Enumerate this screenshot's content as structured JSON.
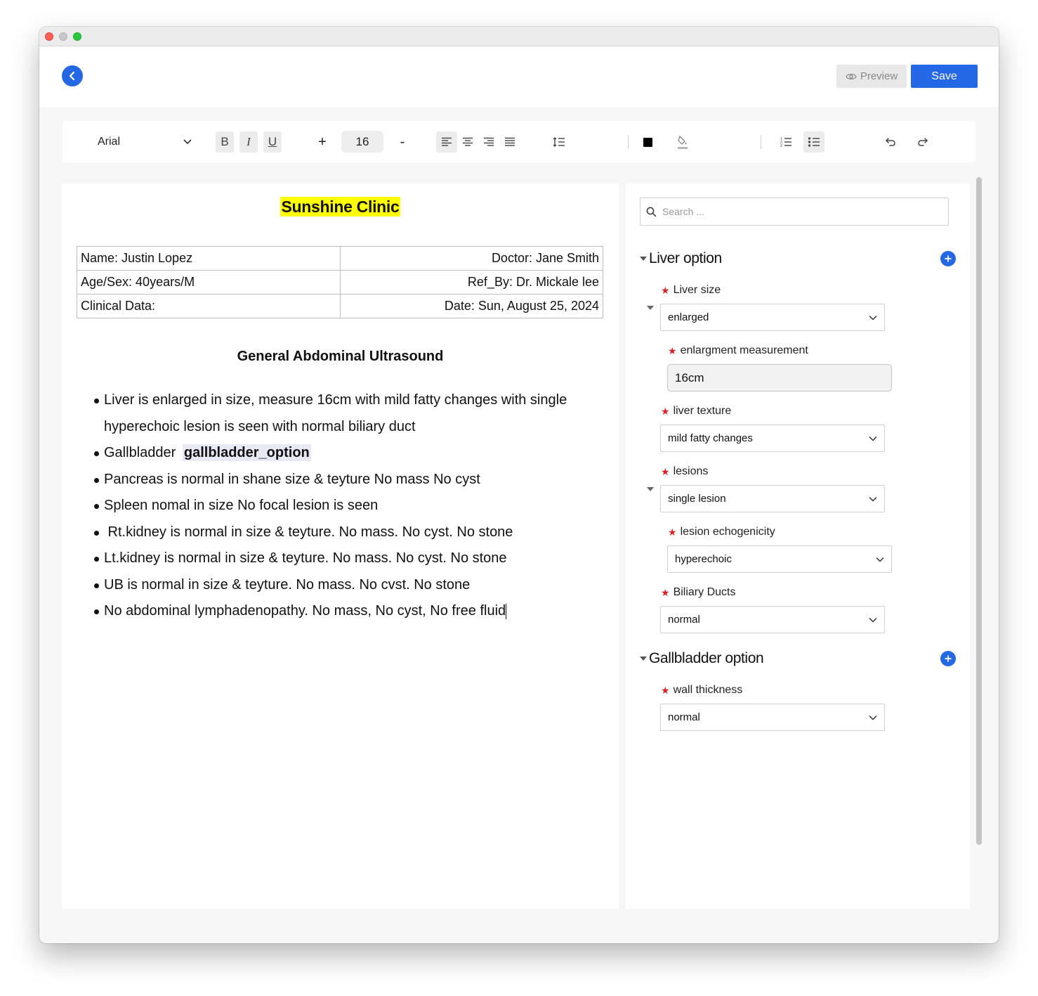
{
  "header": {
    "preview_label": "Preview",
    "save_label": "Save"
  },
  "toolbar": {
    "font_family": "Arial",
    "font_size": "16",
    "bold": "B",
    "italic": "I",
    "underline": "U",
    "increase": "+",
    "decrease": "-"
  },
  "document": {
    "clinic_name": "Sunshine Clinic",
    "patient": {
      "name": "Name: Justin Lopez",
      "doctor": "Doctor: Jane Smith",
      "age_sex": "Age/Sex: 40years/M",
      "ref_by": "Ref_By: Dr. Mickale lee",
      "clinical_data": "Clinical Data:",
      "date": "Date: Sun, August 25, 2024"
    },
    "report_title": "General Abdominal Ultrasound",
    "findings": [
      "Liver is enlarged in size, measure 16cm with mild fatty changes with single hyperechoic lesion is seen with normal biliary duct",
      "Gallbladder",
      "Pancreas is normal in shane size & teyture No mass No cyst",
      "Spleen nomal in size No focal lesion is seen",
      " Rt.kidney is normal in size & teyture. No mass. No cyst. No stone",
      "Lt.kidney is normal in size & teyture. No mass. No cyst. No stone",
      "UB is normal in size & teyture. No mass. No cvst. No stone",
      "No abdominal lymphadenopathy. No mass, No cyst, No free fluid"
    ],
    "gallbladder_token": "gallbladder_option"
  },
  "sidebar": {
    "search_placeholder": "Search ...",
    "liver_section": {
      "title": "Liver option",
      "liver_size_label": "Liver size",
      "liver_size_value": "enlarged",
      "enlargement_label": "enlargment measurement",
      "enlargement_value": "16cm",
      "texture_label": "liver texture",
      "texture_value": "mild fatty changes",
      "lesions_label": "lesions",
      "lesions_value": "single lesion",
      "echogenicity_label": "lesion echogenicity",
      "echogenicity_value": "hyperechoic",
      "biliary_label": "Biliary Ducts",
      "biliary_value": "normal"
    },
    "gallbladder_section": {
      "title": "Gallbladder option",
      "wall_label": "wall thickness",
      "wall_value": "normal"
    }
  },
  "colors": {
    "accent": "#2468e6",
    "highlight": "#ffff00",
    "required": "#e02020"
  }
}
